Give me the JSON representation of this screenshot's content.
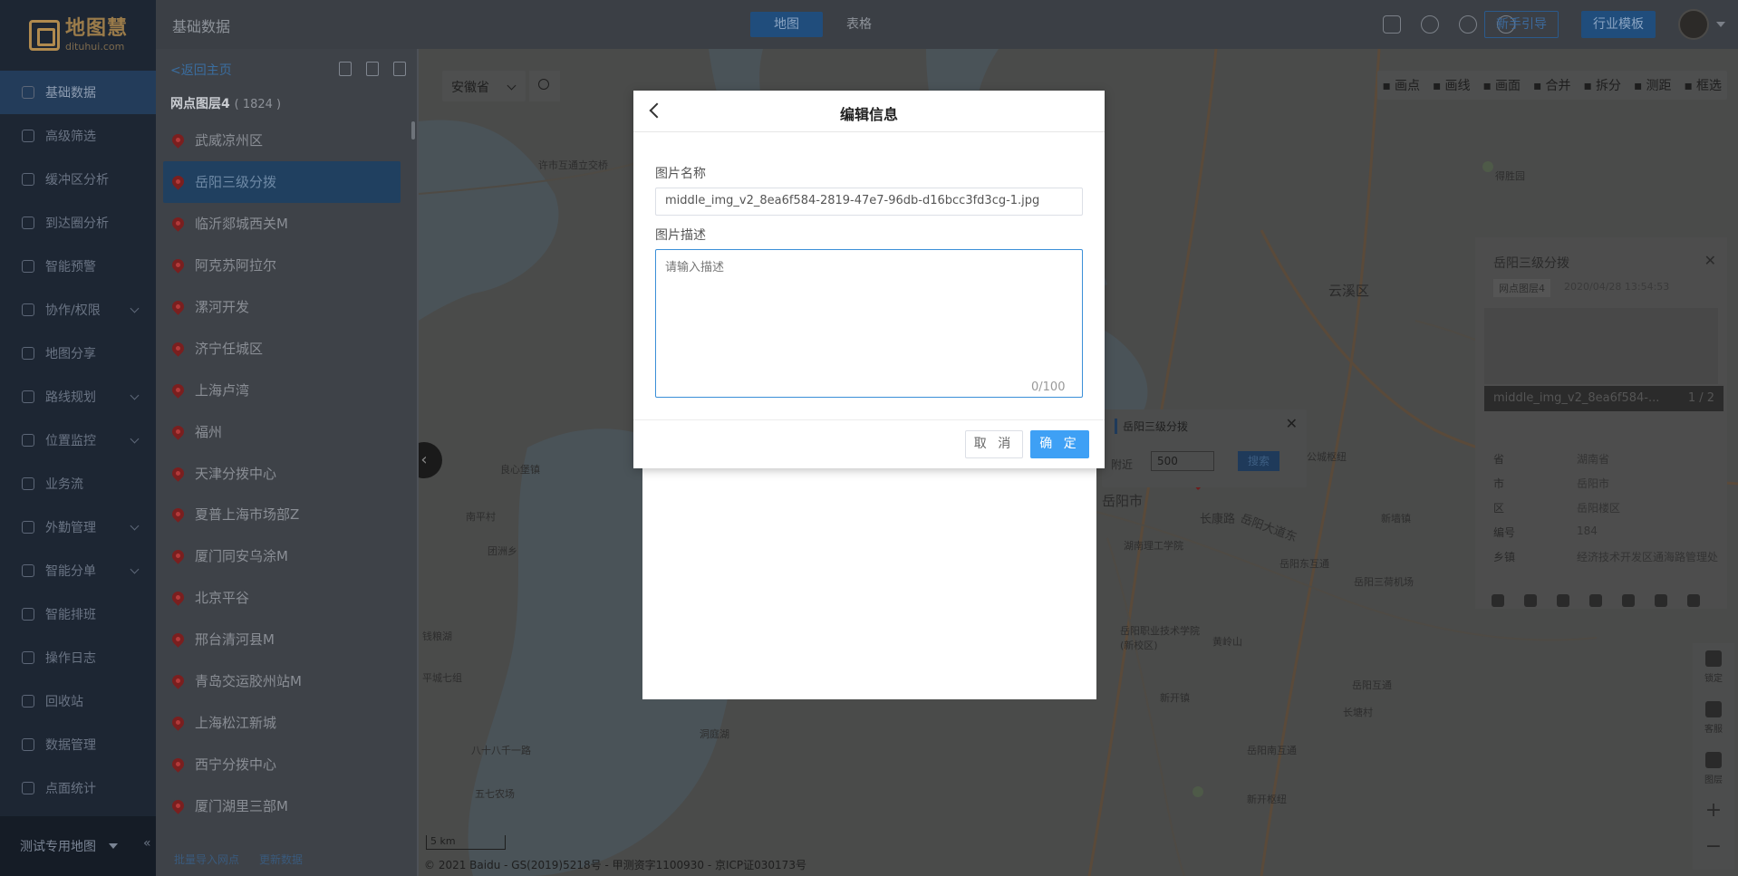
{
  "logo": {
    "cn": "地图慧",
    "en": "dituhui.com"
  },
  "nav": {
    "items": [
      {
        "label": "基础数据",
        "active": true,
        "caret": false
      },
      {
        "label": "高级筛选",
        "caret": false
      },
      {
        "label": "缓冲区分析",
        "caret": false
      },
      {
        "label": "到达圈分析",
        "caret": false
      },
      {
        "label": "智能预警",
        "caret": false
      },
      {
        "label": "协作/权限",
        "caret": true
      },
      {
        "label": "地图分享",
        "caret": false
      },
      {
        "label": "路线规划",
        "caret": true
      },
      {
        "label": "位置监控",
        "caret": true
      },
      {
        "label": "业务流",
        "caret": false
      },
      {
        "label": "外勤管理",
        "caret": true
      },
      {
        "label": "智能分单",
        "caret": true
      },
      {
        "label": "智能排班",
        "caret": false
      },
      {
        "label": "操作日志",
        "caret": false
      },
      {
        "label": "回收站",
        "caret": false
      },
      {
        "label": "数据管理",
        "caret": false
      },
      {
        "label": "点面统计",
        "caret": false
      }
    ],
    "footer_map": "测试专用地图",
    "collapse_glyph": "«"
  },
  "topbar": {
    "crumb": "基础数据",
    "tab_map": "地图",
    "tab_table": "表格",
    "guide": "新手引导",
    "template": "行业模板"
  },
  "panel": {
    "back": "<返回主页",
    "layer_name": "网点图层4",
    "layer_count": "( 1824 )",
    "points": [
      {
        "name": "武威凉州区"
      },
      {
        "name": "岳阳三级分拨",
        "selected": true
      },
      {
        "name": "临沂郯城西关M"
      },
      {
        "name": "阿克苏阿拉尔"
      },
      {
        "name": "漯河开发"
      },
      {
        "name": "济宁任城区"
      },
      {
        "name": "上海卢湾"
      },
      {
        "name": "福州"
      },
      {
        "name": "天津分拨中心"
      },
      {
        "name": "夏普上海市场部Z"
      },
      {
        "name": "厦门同安乌涂M"
      },
      {
        "name": "北京平谷"
      },
      {
        "name": "邢台清河县M"
      },
      {
        "name": "青岛交运胶州站M"
      },
      {
        "name": "上海松江新城"
      },
      {
        "name": "西宁分拨中心"
      },
      {
        "name": "厦门湖里三部M"
      }
    ],
    "footer_import": "批量导入网点",
    "footer_refresh": "更新数据"
  },
  "map": {
    "province": "安徽省",
    "tools": [
      "画点",
      "画线",
      "画面",
      "合并",
      "拆分",
      "测距",
      "框选"
    ],
    "labels": [
      {
        "t": "许市互通立交桥"
      },
      {
        "t": "云溪区"
      },
      {
        "t": "岳阳市"
      },
      {
        "t": "长康路"
      },
      {
        "t": "岳阳大道东"
      },
      {
        "t": "岳阳三荷机场"
      },
      {
        "t": "湖南理工学院"
      },
      {
        "t": "岳阳职业技术学院(新校区)"
      },
      {
        "t": "黄岭山"
      },
      {
        "t": "新开镇"
      },
      {
        "t": "岳阳南互通"
      },
      {
        "t": "岳阳东互通"
      },
      {
        "t": "新开枢纽"
      },
      {
        "t": "岳阳互通"
      },
      {
        "t": "得胜园"
      },
      {
        "t": "公城枢纽"
      },
      {
        "t": "洞庭湖"
      },
      {
        "t": "八十八千一路"
      },
      {
        "t": "五七农场"
      },
      {
        "t": "良心堡镇"
      },
      {
        "t": "南平村"
      },
      {
        "t": "团洲乡"
      },
      {
        "t": "钱粮湖"
      },
      {
        "t": "平城七组"
      },
      {
        "t": "新墙镇"
      },
      {
        "t": "长塘村"
      }
    ],
    "scale": "5 km",
    "copyright": "© 2021 Baidu - GS(2019)5218号 - 甲测资字1100930 - 京ICP证030173号",
    "right_tools": [
      "锁定",
      "客服",
      "图层"
    ],
    "popup": {
      "title": "岳阳三级分拨",
      "near": "附近",
      "distance": "500",
      "search": "搜索"
    },
    "info": {
      "title": "岳阳三级分拨",
      "layer_tag": "网点图层4",
      "time": "2020/04/28 13:54:53",
      "caption": "middle_img_v2_8ea6f584-...",
      "page": "1 / 2",
      "rows": [
        {
          "k": "省",
          "v": "湖南省"
        },
        {
          "k": "市",
          "v": "岳阳市"
        },
        {
          "k": "区",
          "v": "岳阳楼区"
        },
        {
          "k": "编号",
          "v": "184"
        },
        {
          "k": "乡镇",
          "v": "经济技术开发区通海路管理处"
        }
      ]
    }
  },
  "dialog": {
    "title": "编辑信息",
    "name_label": "图片名称",
    "name_value": "middle_img_v2_8ea6f584-2819-47e7-96db-d16bcc3fd3cg-1.jpg",
    "desc_label": "图片描述",
    "desc_placeholder": "请输入描述",
    "counter": "0/100",
    "cancel": "取 消",
    "ok": "确 定"
  }
}
